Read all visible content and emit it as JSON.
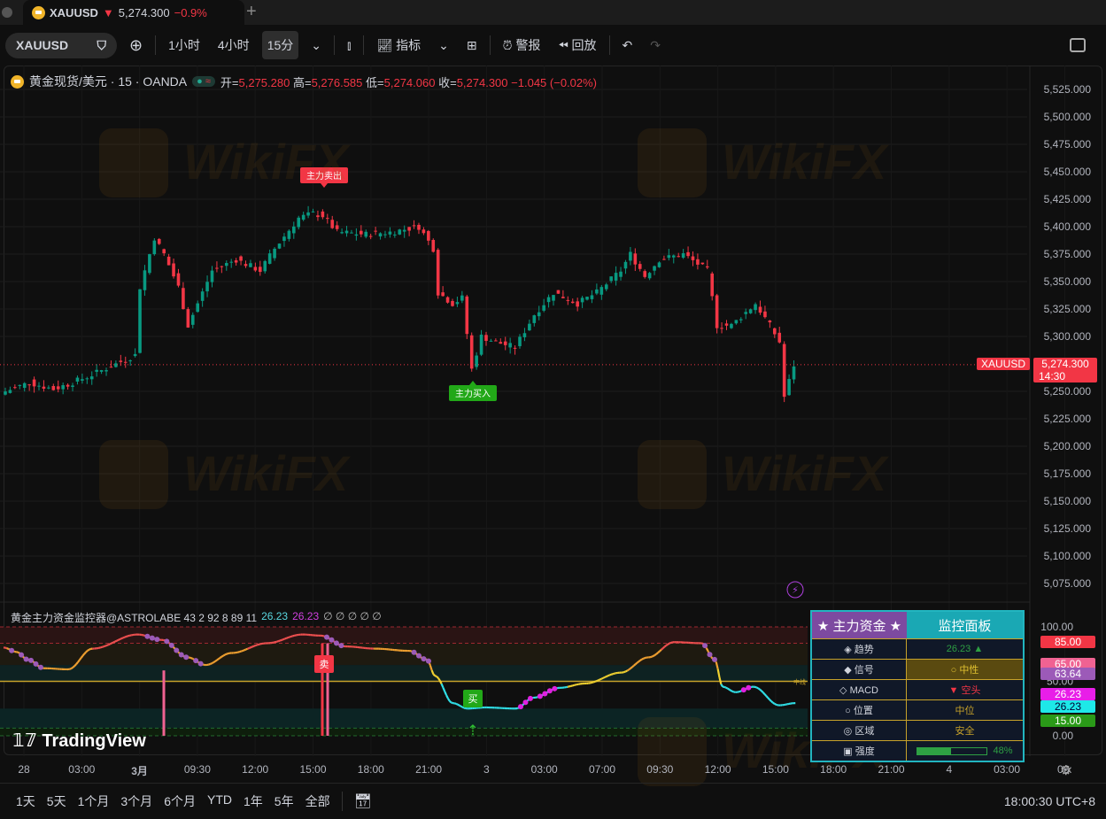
{
  "tab": {
    "symbol": "XAUUSD",
    "price": "5,274.300",
    "change": "−0.9%",
    "new_tab": "+"
  },
  "toolbar": {
    "symbol": "XAUUSD",
    "intervals": [
      "1小时",
      "4小时",
      "15分"
    ],
    "indicators": "指标",
    "alert": "警报",
    "replay": "回放"
  },
  "legend": {
    "title": "黄金现货/美元 · 15 · OANDA",
    "o_label": "开=",
    "o": "5,275.280",
    "h_label": "高=",
    "h": "5,276.585",
    "l_label": "低=",
    "l": "5,274.060",
    "c_label": "收=",
    "c": "5,274.300",
    "chg": "−1.045 (−0.02%)"
  },
  "price_axis": {
    "ticks": [
      "5,525.000",
      "5,500.000",
      "5,475.000",
      "5,450.000",
      "5,425.000",
      "5,400.000",
      "5,375.000",
      "5,350.000",
      "5,325.000",
      "5,300.000",
      "5,250.000",
      "5,225.000",
      "5,200.000",
      "5,175.000",
      "5,150.000",
      "5,125.000",
      "5,100.000",
      "5,075.000"
    ],
    "tick_values": [
      5525,
      5500,
      5475,
      5450,
      5425,
      5400,
      5375,
      5350,
      5325,
      5300,
      5250,
      5225,
      5200,
      5175,
      5150,
      5125,
      5100,
      5075
    ],
    "last_symbol": "XAUUSD",
    "last_price": "5,274.300",
    "countdown": "14:30",
    "last_value": 5274.3
  },
  "signals": {
    "sell": "主力卖出",
    "buy": "主力买入",
    "ind_sell": "卖",
    "ind_buy": "买"
  },
  "candles_keypoints": [
    [
      0,
      5250
    ],
    [
      5,
      5258
    ],
    [
      10,
      5252
    ],
    [
      14,
      5258
    ],
    [
      18,
      5265
    ],
    [
      23,
      5275
    ],
    [
      27,
      5283
    ],
    [
      28,
      5345
    ],
    [
      31,
      5390
    ],
    [
      33,
      5375
    ],
    [
      36,
      5345
    ],
    [
      38,
      5310
    ],
    [
      40,
      5330
    ],
    [
      43,
      5360
    ],
    [
      48,
      5370
    ],
    [
      53,
      5360
    ],
    [
      56,
      5380
    ],
    [
      61,
      5408
    ],
    [
      64,
      5412
    ],
    [
      66,
      5410
    ],
    [
      69,
      5395
    ],
    [
      75,
      5393
    ],
    [
      80,
      5395
    ],
    [
      86,
      5400
    ],
    [
      89,
      5380
    ],
    [
      90,
      5340
    ],
    [
      93,
      5330
    ],
    [
      95,
      5335
    ],
    [
      97,
      5270
    ],
    [
      99,
      5300
    ],
    [
      102,
      5295
    ],
    [
      106,
      5290
    ],
    [
      110,
      5320
    ],
    [
      114,
      5340
    ],
    [
      119,
      5330
    ],
    [
      123,
      5340
    ],
    [
      128,
      5360
    ],
    [
      130,
      5375
    ],
    [
      133,
      5355
    ],
    [
      136,
      5370
    ],
    [
      141,
      5375
    ],
    [
      146,
      5360
    ],
    [
      148,
      5310
    ],
    [
      151,
      5310
    ],
    [
      156,
      5330
    ],
    [
      159,
      5310
    ],
    [
      161,
      5295
    ],
    [
      162,
      5245
    ],
    [
      164,
      5274
    ]
  ],
  "indicator": {
    "legend": "黄金主力资金监控器@ASTROLABE 43 2 92 8 89 11",
    "v1": "26.23",
    "v2": "26.23",
    "na": "∅ ∅ ∅ ∅ ∅",
    "keypoints": [
      [
        0,
        81
      ],
      [
        8,
        77
      ],
      [
        15,
        70
      ],
      [
        25,
        62
      ],
      [
        40,
        61
      ],
      [
        55,
        80
      ],
      [
        83,
        93
      ],
      [
        98,
        88
      ],
      [
        114,
        72
      ],
      [
        125,
        65
      ],
      [
        141,
        76
      ],
      [
        163,
        85
      ],
      [
        185,
        93
      ],
      [
        196,
        92
      ],
      [
        212,
        82
      ],
      [
        230,
        80
      ],
      [
        251,
        78
      ],
      [
        262,
        70
      ],
      [
        267,
        55
      ],
      [
        278,
        30
      ],
      [
        287,
        25
      ],
      [
        298,
        26
      ],
      [
        317,
        25
      ],
      [
        328,
        35
      ],
      [
        344,
        44
      ],
      [
        360,
        48
      ],
      [
        382,
        58
      ],
      [
        399,
        72
      ],
      [
        415,
        86
      ],
      [
        432,
        85
      ],
      [
        440,
        70
      ],
      [
        445,
        45
      ],
      [
        453,
        40
      ],
      [
        464,
        45
      ],
      [
        480,
        28
      ],
      [
        490,
        30
      ]
    ],
    "axis_ticks": [
      "100.00",
      "50.00",
      "0.00"
    ],
    "labels": [
      {
        "t": "85.00",
        "c": "#f23645",
        "v": 85
      },
      {
        "t": "65.00",
        "c": "#f06292",
        "v": 65
      },
      {
        "t": "63.64",
        "c": "#9c5ab8",
        "v": 56
      },
      {
        "t": "26.23",
        "c": "#e81ee8",
        "v": 37
      },
      {
        "t": "26.23",
        "c": "#1ee8e8",
        "v": 26
      },
      {
        "t": "15.00",
        "c": "#2a9a18",
        "v": 13
      }
    ],
    "mid_tag": "中线"
  },
  "panel": {
    "h1": "★ 主力资金 ★",
    "h2": "监控面板",
    "rows": [
      {
        "l": "◈ 趋势",
        "v": "26.23 ▲",
        "c": "#2ea043"
      },
      {
        "l": "◆ 信号",
        "v": "○ 中性",
        "c": "#e0c030"
      },
      {
        "l": "◇ MACD",
        "v": "▼ 空头",
        "c": "#f23645"
      },
      {
        "l": "○ 位置",
        "v": "中位",
        "c": "#c7a22a"
      },
      {
        "l": "◎ 区域",
        "v": "安全",
        "c": "#c7a22a"
      },
      {
        "l": "▣ 强度",
        "v": "48%",
        "c": "#2ea043"
      }
    ],
    "strength": 0.48
  },
  "time_axis": [
    "28",
    "03:00",
    "3月",
    "09:30",
    "12:00",
    "15:00",
    "18:00",
    "21:00",
    "3",
    "03:00",
    "07:00",
    "09:30",
    "12:00",
    "15:00",
    "18:00",
    "21:00",
    "4",
    "03:00",
    "06:"
  ],
  "ranges": [
    "1天",
    "5天",
    "1个月",
    "3个月",
    "6个月",
    "YTD",
    "1年",
    "5年",
    "全部"
  ],
  "clock": "18:00:30 UTC+8",
  "brand": "TradingView",
  "watermark": "WikiFX",
  "colors": {
    "up": "#089981",
    "down": "#f23645",
    "accent": "#22b5c0"
  }
}
